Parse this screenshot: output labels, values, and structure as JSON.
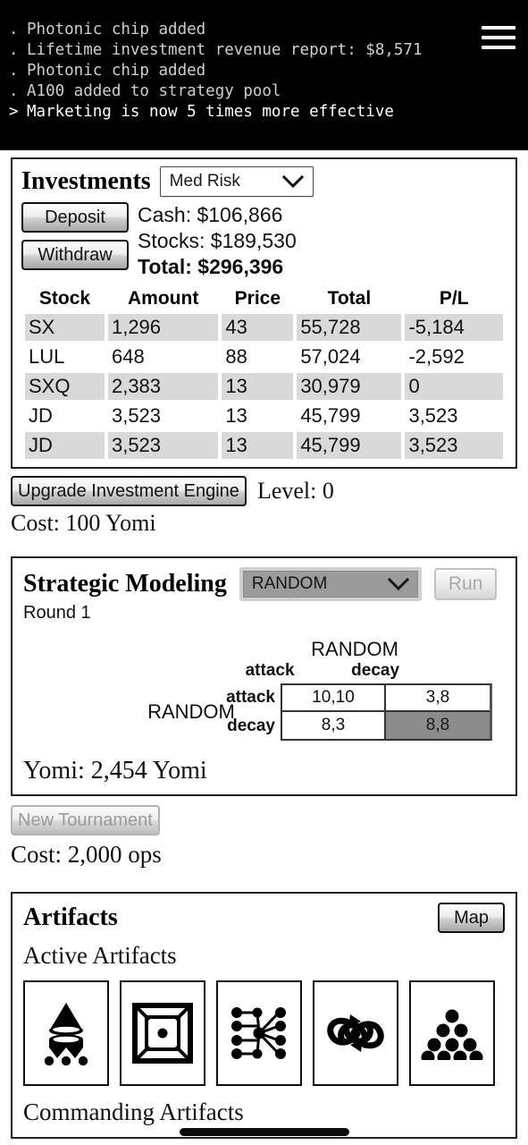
{
  "console": {
    "lines": [
      {
        "marker": ".",
        "text": "Photonic chip added",
        "current": false
      },
      {
        "marker": ".",
        "text": "Lifetime investment revenue report: $8,571",
        "current": false
      },
      {
        "marker": ".",
        "text": "Photonic chip added",
        "current": false
      },
      {
        "marker": ".",
        "text": "A100 added to strategy pool",
        "current": false
      },
      {
        "marker": ">",
        "text": "Marketing is now 5 times more effective",
        "current": true
      }
    ],
    "menu_icon": "hamburger-menu-icon"
  },
  "investments": {
    "title": "Investments",
    "risk_select": {
      "value": "Med Risk",
      "icon": "chevron-down-icon"
    },
    "deposit_label": "Deposit",
    "withdraw_label": "Withdraw",
    "cash_label": "Cash: $106,866",
    "stocks_label": "Stocks: $189,530",
    "total_label": "Total: $296,396",
    "columns": [
      "Stock",
      "Amount",
      "Price",
      "Total",
      "P/L"
    ],
    "rows": [
      {
        "stock": "SX",
        "amount": "1,296",
        "price": "43",
        "total": "55,728",
        "pl": "-5,184"
      },
      {
        "stock": "LUL",
        "amount": "648",
        "price": "88",
        "total": "57,024",
        "pl": "-2,592"
      },
      {
        "stock": "SXQ",
        "amount": "2,383",
        "price": "13",
        "total": "30,979",
        "pl": "0"
      },
      {
        "stock": "JD",
        "amount": "3,523",
        "price": "13",
        "total": "45,799",
        "pl": "3,523"
      },
      {
        "stock": "JD",
        "amount": "3,523",
        "price": "13",
        "total": "45,799",
        "pl": "3,523"
      }
    ],
    "upgrade_label": "Upgrade Investment Engine",
    "level_label": "Level: 0",
    "cost_label": "Cost: 100 Yomi"
  },
  "strategic": {
    "title": "Strategic Modeling",
    "opponent_select": {
      "value": "RANDOM",
      "icon": "chevron-down-icon"
    },
    "run_label": "Run",
    "round_label": "Round 1",
    "column_player": "RANDOM",
    "row_player": "RANDOM",
    "matrix": {
      "col_headers": [
        "attack",
        "decay"
      ],
      "row_headers": [
        "attack",
        "decay"
      ],
      "cells": [
        [
          "10,10",
          "3,8"
        ],
        [
          "8,3",
          "8,8"
        ]
      ],
      "highlight": {
        "row": 1,
        "col": 1
      }
    },
    "yomi_label": "Yomi: 2,454 Yomi",
    "tournament_label": "New Tournament",
    "tournament_cost": "Cost: 2,000 ops"
  },
  "artifacts": {
    "title": "Artifacts",
    "map_label": "Map",
    "active_label": "Active Artifacts",
    "items": [
      {
        "icon": "cone-tripod-artifact-icon"
      },
      {
        "icon": "nested-square-artifact-icon"
      },
      {
        "icon": "neural-network-artifact-icon"
      },
      {
        "icon": "interlocking-knot-artifact-icon"
      },
      {
        "icon": "dot-pyramid-artifact-icon"
      }
    ],
    "commanding_label": "Commanding Artifacts"
  },
  "colors": {
    "console_bg": "#000000",
    "console_text": "#cfcfcf",
    "panel_border": "#222222",
    "row_shade": "#d9d9d9",
    "matrix_highlight": "#8c8c8c",
    "select_grey": "#9b9b9b"
  }
}
